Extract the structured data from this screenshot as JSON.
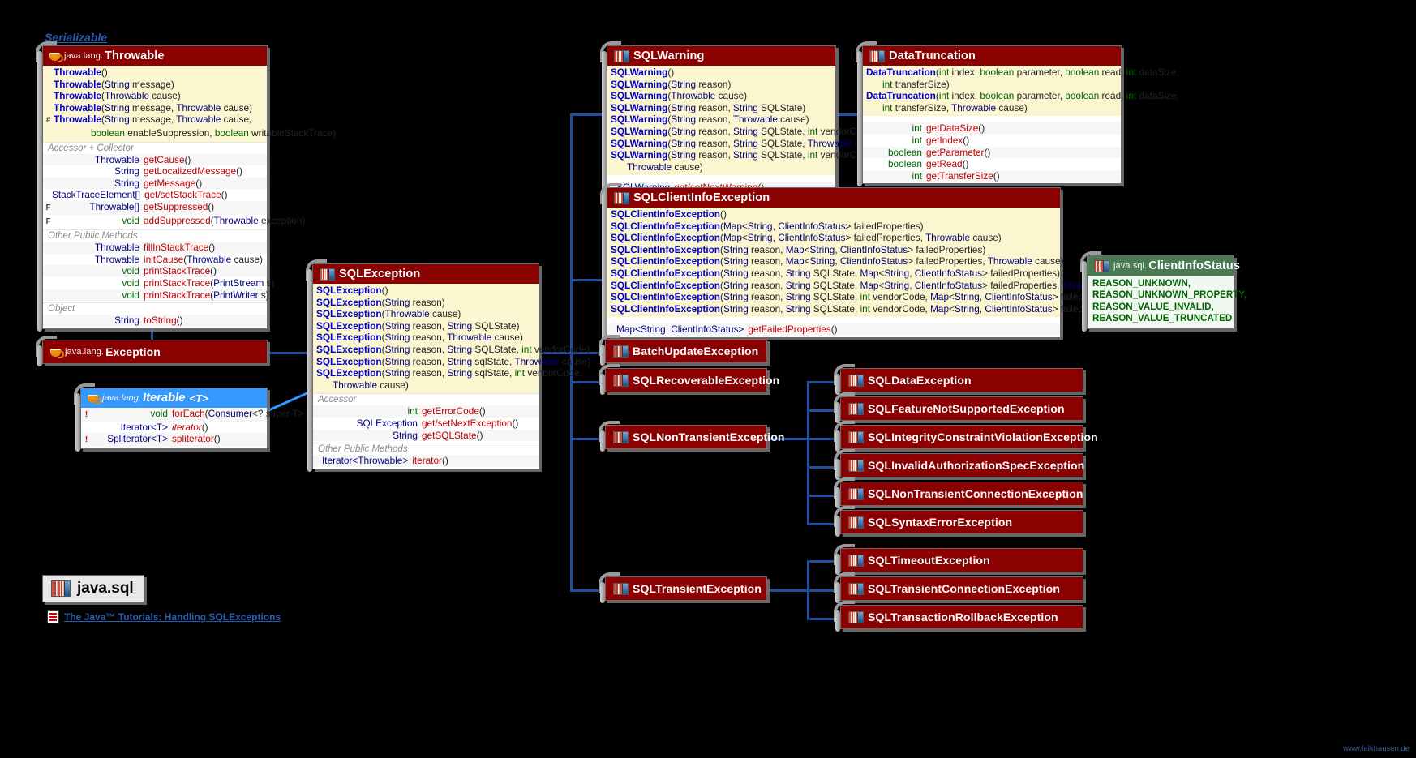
{
  "meta": {
    "serializable_label": "Serializable",
    "package_label": "java.sql",
    "tutorial_link": "The Java™ Tutorials: Handling SQLExceptions",
    "credit": "www.falkhausen.de",
    "accent_line": "#1f4ea1",
    "header_color": "#8b0000",
    "interface_color": "#3399ff",
    "enum_color": "#4a7a52"
  },
  "sections": {
    "accessor_collector": "Accessor + Collector",
    "accessor": "Accessor",
    "other_public": "Other Public Methods",
    "object": "Object"
  },
  "throwable": {
    "pkg": "java.lang.",
    "name": "Throwable",
    "ctors": [
      [
        {
          "m": ""
        },
        {
          "t": ""
        },
        {
          "n": "Throwable"
        },
        {
          "p": " ()"
        }
      ],
      [
        {
          "m": ""
        },
        {
          "t": ""
        },
        {
          "n": "Throwable"
        },
        {
          "p": " (String message)"
        }
      ],
      [
        {
          "m": ""
        },
        {
          "t": ""
        },
        {
          "n": "Throwable"
        },
        {
          "p": " (Throwable cause)"
        }
      ],
      [
        {
          "m": ""
        },
        {
          "t": ""
        },
        {
          "n": "Throwable"
        },
        {
          "p": " (String message, Throwable cause)"
        }
      ],
      [
        {
          "m": "#"
        },
        {
          "t": ""
        },
        {
          "n": "Throwable"
        },
        {
          "p": " (String message, Throwable cause,"
        }
      ],
      [
        {
          "m": ""
        },
        {
          "t": ""
        },
        {
          "n": ""
        },
        {
          "p": "boolean enableSuppression, boolean writableStackTrace)"
        }
      ]
    ],
    "accessors": [
      {
        "mod": "",
        "type": "Throwable",
        "name": "getCause",
        "args": " ()"
      },
      {
        "mod": "",
        "type": "String",
        "name": "getLocalizedMessage",
        "args": " ()"
      },
      {
        "mod": "",
        "type": "String",
        "name": "getMessage",
        "args": " ()"
      },
      {
        "mod": "",
        "type": "StackTraceElement[]",
        "name": "get/setStackTrace",
        "args": " ()"
      },
      {
        "mod": "F",
        "type": "Throwable[]",
        "name": "getSuppressed",
        "args": " ()"
      },
      {
        "mod": "F",
        "type": "void",
        "name": "addSuppressed",
        "args": " (Throwable exception)"
      }
    ],
    "other": [
      {
        "mod": "",
        "type": "Throwable",
        "name": "fillInStackTrace",
        "args": " ()"
      },
      {
        "mod": "",
        "type": "Throwable",
        "name": "initCause",
        "args": " (Throwable cause)"
      },
      {
        "mod": "",
        "type": "void",
        "name": "printStackTrace",
        "args": " ()"
      },
      {
        "mod": "",
        "type": "void",
        "name": "printStackTrace",
        "args": " (PrintStream s)"
      },
      {
        "mod": "",
        "type": "void",
        "name": "printStackTrace",
        "args": " (PrintWriter s)"
      }
    ],
    "object_methods": [
      {
        "mod": "",
        "type": "String",
        "name": "toString",
        "args": " ()"
      }
    ]
  },
  "exception": {
    "pkg": "java.lang.",
    "name": "Exception"
  },
  "iterable": {
    "pkg": "java.lang.",
    "name": "Iterable",
    "generic": "<T>",
    "methods": [
      {
        "mod": "!",
        "type": "void",
        "name": "forEach",
        "args": " (Consumer<? super T> action)",
        "abstract": false
      },
      {
        "mod": "",
        "type": "Iterator<T>",
        "name": "iterator",
        "args": " ()",
        "abstract": true
      },
      {
        "mod": "!",
        "type": "Spliterator<T>",
        "name": "spliterator",
        "args": " ()",
        "abstract": false
      }
    ]
  },
  "sqlexception": {
    "name": "SQLException",
    "ctors": [
      "SQLException ()",
      "SQLException (String reason)",
      "SQLException (Throwable cause)",
      "SQLException (String reason, String SQLState)",
      "SQLException (String reason, Throwable cause)",
      "SQLException (String reason, String SQLState, int vendorCode)",
      "SQLException (String reason, String sqlState, Throwable cause)",
      "SQLException (String reason, String sqlState, int vendorCode,",
      "Throwable cause)"
    ],
    "accessors": [
      {
        "mod": "",
        "type": "int",
        "name": "getErrorCode",
        "args": " ()"
      },
      {
        "mod": "",
        "type": "SQLException",
        "name": "get/setNextException",
        "args": " ()"
      },
      {
        "mod": "",
        "type": "String",
        "name": "getSQLState",
        "args": " ()"
      }
    ],
    "other": [
      {
        "mod": "",
        "type": "Iterator<Throwable>",
        "name": "iterator",
        "args": " ()"
      }
    ]
  },
  "sqlwarning": {
    "name": "SQLWarning",
    "ctors": [
      "SQLWarning ()",
      "SQLWarning (String reason)",
      "SQLWarning (Throwable cause)",
      "SQLWarning (String reason, String SQLState)",
      "SQLWarning (String reason, Throwable cause)",
      "SQLWarning (String reason, String SQLState, int vendorCode)",
      "SQLWarning (String reason, String SQLState, Throwable cause)",
      "SQLWarning (String reason, String SQLState, int vendorCode,",
      "Throwable cause)"
    ],
    "methods": [
      {
        "mod": "",
        "type": "SQLWarning",
        "name": "get/setNextWarning",
        "args": " ()"
      }
    ]
  },
  "datatruncation": {
    "name": "DataTruncation",
    "ctors": [
      "DataTruncation (int index, boolean parameter, boolean read, int dataSize,",
      "int transferSize)",
      "DataTruncation (int index, boolean parameter, boolean read, int dataSize,",
      "int transferSize, Throwable cause)"
    ],
    "methods": [
      {
        "mod": "",
        "type": "int",
        "name": "getDataSize",
        "args": " ()"
      },
      {
        "mod": "",
        "type": "int",
        "name": "getIndex",
        "args": " ()"
      },
      {
        "mod": "",
        "type": "boolean",
        "name": "getParameter",
        "args": " ()"
      },
      {
        "mod": "",
        "type": "boolean",
        "name": "getRead",
        "args": " ()"
      },
      {
        "mod": "",
        "type": "int",
        "name": "getTransferSize",
        "args": " ()"
      }
    ]
  },
  "clientinfoexception": {
    "name": "SQLClientInfoException",
    "ctors": [
      "SQLClientInfoException ()",
      "SQLClientInfoException (Map<String, ClientInfoStatus> failedProperties)",
      "SQLClientInfoException (Map<String, ClientInfoStatus> failedProperties, Throwable cause)",
      "SQLClientInfoException (String reason, Map<String, ClientInfoStatus> failedProperties)",
      "SQLClientInfoException (String reason, Map<String, ClientInfoStatus> failedProperties, Throwable cause)",
      "SQLClientInfoException (String reason, String SQLState, Map<String, ClientInfoStatus> failedProperties)",
      "SQLClientInfoException (String reason, String SQLState, Map<String, ClientInfoStatus> failedProperties, Throwable cause)",
      "SQLClientInfoException (String reason, String SQLState, int vendorCode, Map<String, ClientInfoStatus> failedProperties)",
      "SQLClientInfoException (String reason, String SQLState, int vendorCode, Map<String, ClientInfoStatus> failedProperties, Throwable cause)"
    ],
    "methods": [
      {
        "mod": "",
        "type": "Map<String, ClientInfoStatus>",
        "name": "getFailedProperties",
        "args": " ()"
      }
    ]
  },
  "clientinfostatus": {
    "pkg": "java.sql.",
    "name": "ClientInfoStatus",
    "constants": [
      "REASON_UNKNOWN,",
      "REASON_UNKNOWN_PROPERTY,",
      "REASON_VALUE_INVALID,",
      "REASON_VALUE_TRUNCATED"
    ]
  },
  "simple_boxes": {
    "batch_update": "BatchUpdateException",
    "recoverable": "SQLRecoverableException",
    "nontransient": "SQLNonTransientException",
    "transient": "SQLTransientException",
    "data": "SQLDataException",
    "feature_not_supported": "SQLFeatureNotSupportedException",
    "integrity": "SQLIntegrityConstraintViolationException",
    "invalid_auth": "SQLInvalidAuthorizationSpecException",
    "nontransient_conn": "SQLNonTransientConnectionException",
    "syntax": "SQLSyntaxErrorException",
    "timeout": "SQLTimeoutException",
    "transient_conn": "SQLTransientConnectionException",
    "rollback": "SQLTransactionRollbackException"
  }
}
